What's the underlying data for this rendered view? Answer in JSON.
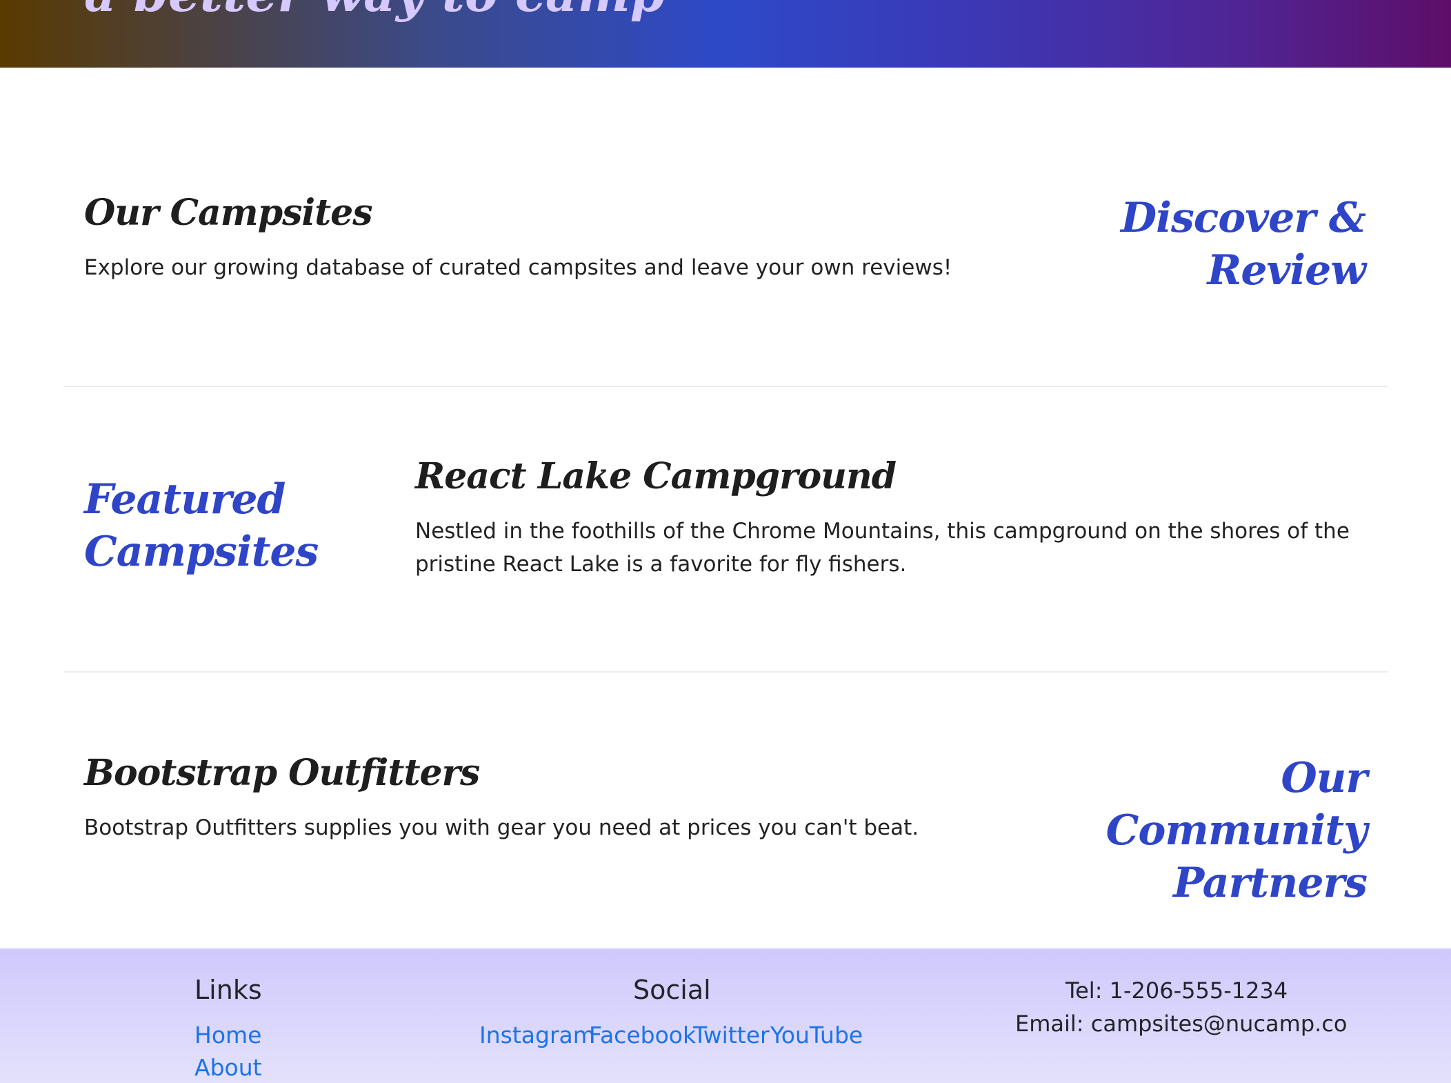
{
  "hero": {
    "tagline": "a better way to camp"
  },
  "sections": {
    "campsites": {
      "title": "Our Campsites",
      "description": "Explore our growing database of curated campsites and leave your own reviews!",
      "side_heading_line1": "Discover &",
      "side_heading_line2": "Review"
    },
    "featured": {
      "side_heading_line1": "Featured",
      "side_heading_line2": "Campsites",
      "title": "React Lake Campground",
      "description_line1": "Nestled in the foothills of the Chrome Mountains, this campground on the shores of the",
      "description_line2": "pristine React Lake is a favorite for fly fishers."
    },
    "partners": {
      "title": "Bootstrap Outfitters",
      "description": "Bootstrap Outfitters supplies you with gear you need at prices you can't beat.",
      "side_heading_line1": "Our Community",
      "side_heading_line2": "Partners"
    }
  },
  "footer": {
    "links_heading": "Links",
    "links": [
      "Home",
      "About"
    ],
    "social_heading": "Social",
    "social_links": [
      "Instagram",
      "Facebook",
      "Twitter",
      "YouTube"
    ],
    "tel": "Tel: 1-206-555-1234",
    "email": "Email: campsites@nucamp.co"
  },
  "colors": {
    "accent_blue": "#2f45c8",
    "link_blue": "#1a73e8",
    "footer_bg": "#d8d4fc"
  }
}
